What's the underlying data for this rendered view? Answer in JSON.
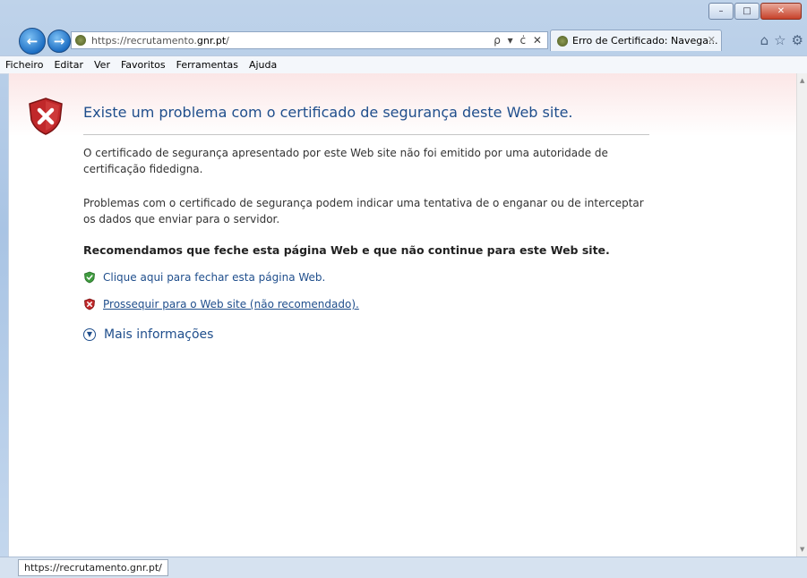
{
  "browser": {
    "address_url_prefix": "https://recrutamento.",
    "address_url_domain": "gnr.pt",
    "address_url_suffix": "/",
    "address_tools": "ρ ▾ ċ ✕",
    "tab_title": "Erro de Certificado: Navega...",
    "tab_close": "✕",
    "window_buttons": {
      "minimize": "–",
      "maximize": "□",
      "close": "✕"
    },
    "nav": {
      "back": "←",
      "forward": "→"
    },
    "toolbar_icons": {
      "home": "⌂",
      "favorites": "☆",
      "tools": "⚙"
    }
  },
  "menu": [
    "Ficheiro",
    "Editar",
    "Ver",
    "Favoritos",
    "Ferramentas",
    "Ajuda"
  ],
  "page": {
    "heading": "Existe um problema com o certificado de segurança deste Web site.",
    "paragraph1": "O certificado de segurança apresentado por este Web site não foi emitido por uma autoridade de certificação fidedigna.",
    "paragraph2": "Problemas com o certificado de segurança podem indicar uma tentativa de o enganar ou de interceptar os dados que enviar para o servidor.",
    "recommendation": "Recomendamos que feche esta página Web e que não continue para este Web site.",
    "close_link": "Clique aqui para fechar esta página Web.",
    "continue_link": "Prossequir para o Web site (não recomendado).",
    "more_info": "Mais informações"
  },
  "status": {
    "url": "https://recrutamento.gnr.pt/"
  },
  "colors": {
    "heading": "#1f4e8c",
    "shield_red": "#c0282a",
    "shield_green": "#3f9b3f"
  }
}
